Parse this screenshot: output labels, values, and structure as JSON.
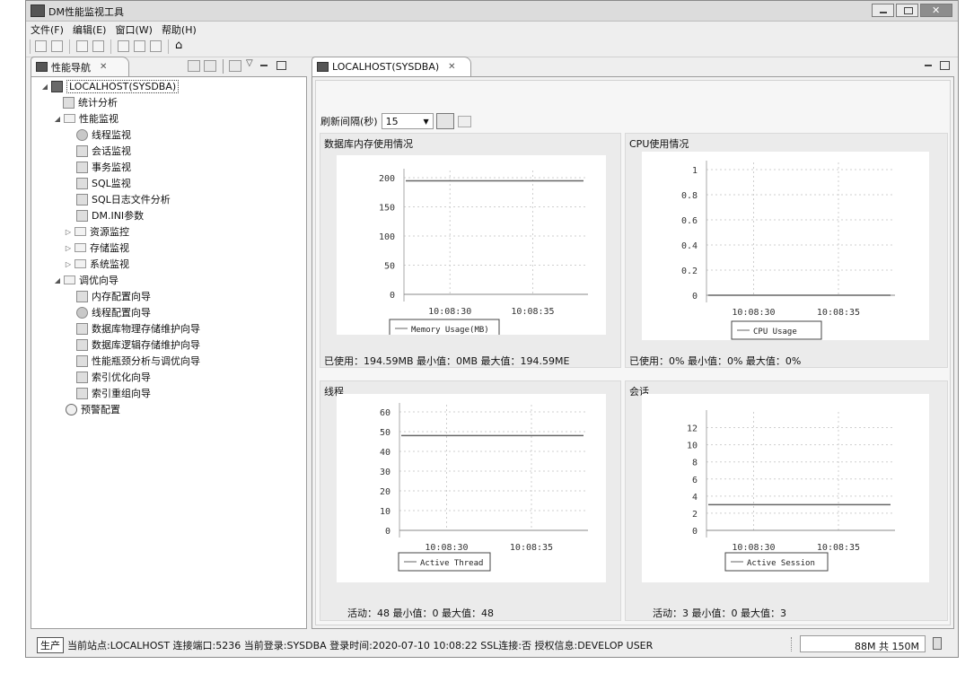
{
  "window": {
    "title": "DM性能监视工具"
  },
  "menu": [
    "文件(F)",
    "编辑(E)",
    "窗口(W)",
    "帮助(H)"
  ],
  "left_tab": {
    "label": "性能导航"
  },
  "right_tab": {
    "label": "LOCALHOST(SYSDBA)"
  },
  "tree": {
    "root": "LOCALHOST(SYSDBA)",
    "stats": "统计分析",
    "perf": "性能监视",
    "perf_items": [
      "线程监视",
      "会话监视",
      "事务监视",
      "SQL监视",
      "SQL日志文件分析",
      "DM.INI参数"
    ],
    "resource": "资源监控",
    "storage": "存储监视",
    "system": "系统监视",
    "tuning": "调优向导",
    "tuning_items": [
      "内存配置向导",
      "线程配置向导",
      "数据库物理存储维护向导",
      "数据库逻辑存储维护向导",
      "性能瓶颈分析与调优向导",
      "索引优化向导",
      "索引重组向导"
    ],
    "alert": "预警配置"
  },
  "refresh": {
    "label": "刷新间隔(秒)",
    "value": "15"
  },
  "panels": [
    {
      "title": "数据库内存使用情况",
      "stats": "已使用：194.59MB    最小值：0MB    最大值：194.59ME"
    },
    {
      "title": "CPU使用情况",
      "stats": "已使用：0%    最小值：0%    最大值：0%"
    },
    {
      "title": "线程",
      "stats": "活动：48    最小值：0    最大值：48"
    },
    {
      "title": "会话",
      "stats": "活动：3    最小值：0    最大值：3"
    }
  ],
  "chart_data": [
    {
      "type": "line",
      "title": "数据库内存使用情况",
      "yticks": [
        "200",
        "150",
        "100",
        "50",
        "0"
      ],
      "ylim": [
        0,
        200
      ],
      "xticks": [
        "10:08:30",
        "10:08:35"
      ],
      "series": [
        {
          "name": "Memory Usage(MB)",
          "values": [
            194.59,
            194.59
          ]
        }
      ]
    },
    {
      "type": "line",
      "title": "CPU使用情况",
      "yticks": [
        "1",
        "0.8",
        "0.6",
        "0.4",
        "0.2",
        "0"
      ],
      "ylim": [
        0,
        1
      ],
      "xticks": [
        "10:08:30",
        "10:08:35"
      ],
      "series": [
        {
          "name": "CPU Usage",
          "values": [
            0,
            0
          ]
        }
      ]
    },
    {
      "type": "line",
      "title": "线程",
      "yticks": [
        "60",
        "50",
        "40",
        "30",
        "20",
        "10",
        "0"
      ],
      "ylim": [
        0,
        60
      ],
      "xticks": [
        "10:08:30",
        "10:08:35"
      ],
      "series": [
        {
          "name": "Active Thread",
          "values": [
            48,
            48
          ]
        }
      ]
    },
    {
      "type": "line",
      "title": "会话",
      "yticks": [
        "12",
        "10",
        "8",
        "6",
        "4",
        "2",
        "0"
      ],
      "ylim": [
        0,
        13
      ],
      "xticks": [
        "10:08:30",
        "10:08:35"
      ],
      "series": [
        {
          "name": "Active Session",
          "values": [
            3,
            3
          ]
        }
      ]
    }
  ],
  "status": {
    "mode": "生产",
    "info": "当前站点:LOCALHOST    连接端口:5236    当前登录:SYSDBA    登录时间:2020-07-10 10:08:22    SSL连接:否    授权信息:DEVELOP USER",
    "memory": "88M 共 150M"
  }
}
